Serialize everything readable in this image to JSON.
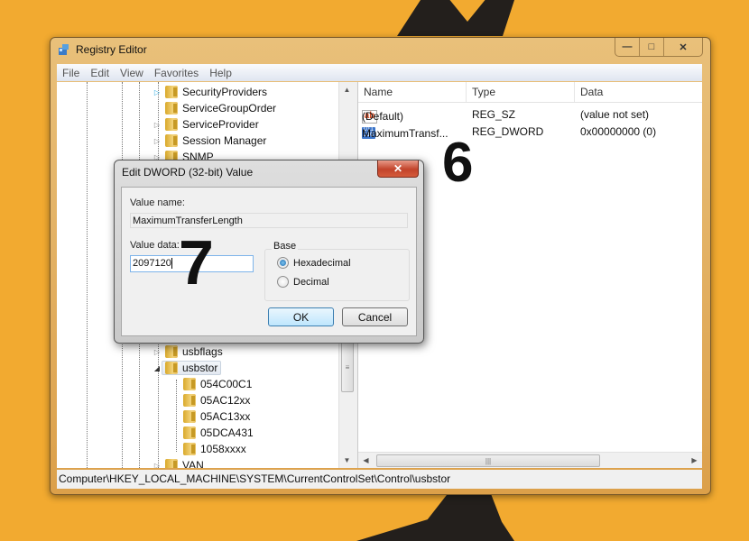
{
  "window": {
    "title": "Registry Editor",
    "caption_buttons": {
      "minimize": "—",
      "maximize": "□",
      "close": "✕"
    }
  },
  "menu": [
    "File",
    "Edit",
    "View",
    "Favorites",
    "Help"
  ],
  "tree": {
    "upper_items": [
      "SecurityProviders",
      "ServiceGroupOrder",
      "ServiceProvider",
      "Session Manager",
      "SNMP"
    ],
    "lower_items": [
      {
        "label": "usbflags",
        "expanded": false
      },
      {
        "label": "usbstor",
        "expanded": true,
        "selected": true
      }
    ],
    "usbstor_children": [
      "054C00C1",
      "05AC12xx",
      "05AC13xx",
      "05DCA431",
      "1058xxxx"
    ],
    "trailing_item": "VAN"
  },
  "list": {
    "columns": [
      "Name",
      "Type",
      "Data"
    ],
    "rows": [
      {
        "icon": "string-value-icon",
        "name": "(Default)",
        "type": "REG_SZ",
        "data": "(value not set)"
      },
      {
        "icon": "binary-value-icon",
        "name": "MaximumTransf...",
        "type": "REG_DWORD",
        "data": "0x00000000 (0)"
      }
    ]
  },
  "statusbar": {
    "path": "Computer\\HKEY_LOCAL_MACHINE\\SYSTEM\\CurrentControlSet\\Control\\usbstor"
  },
  "dialog": {
    "title": "Edit DWORD (32-bit) Value",
    "close": "✕",
    "value_name_label": "Value name:",
    "value_name": "MaximumTransferLength",
    "value_data_label": "Value data:",
    "value_data": "2097120",
    "base_label": "Base",
    "base_options": [
      {
        "label": "Hexadecimal",
        "selected": true
      },
      {
        "label": "Decimal",
        "selected": false
      }
    ],
    "ok": "OK",
    "cancel": "Cancel"
  },
  "annotations": {
    "step6": "6",
    "step7": "7"
  },
  "colors": {
    "background": "#f2aa30",
    "silhouette": "#231f1c"
  }
}
